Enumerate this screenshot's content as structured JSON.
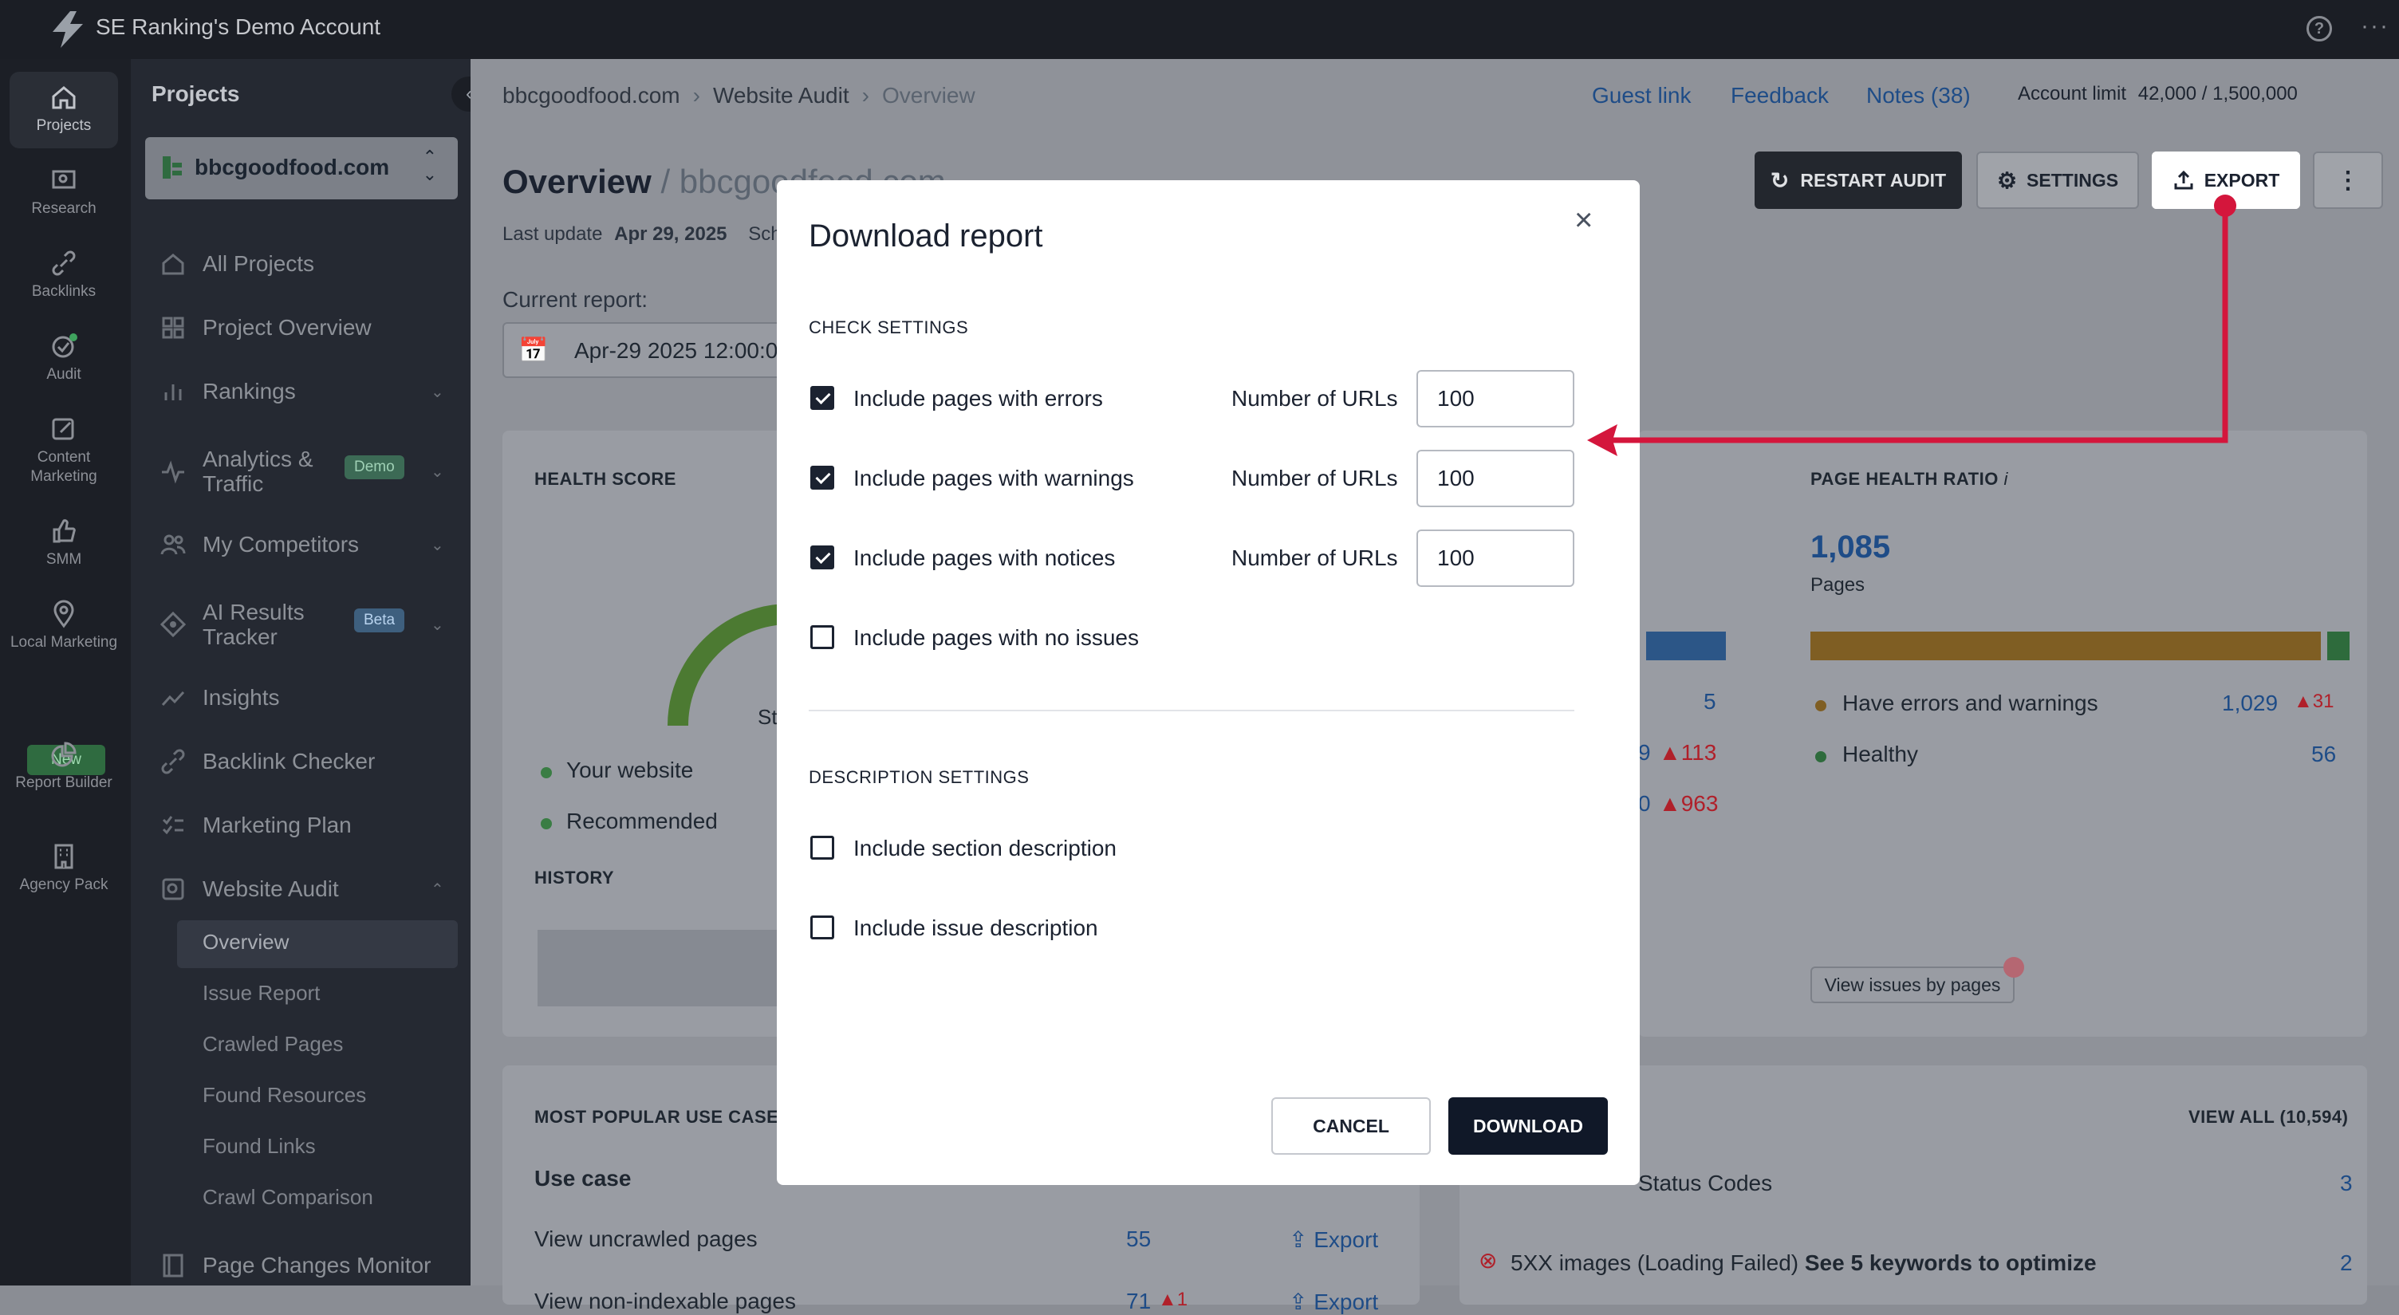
{
  "topbar": {
    "account_name": "SE Ranking's Demo Account",
    "help": "?",
    "more": "···"
  },
  "rail": [
    {
      "label": "Projects"
    },
    {
      "label": "Research"
    },
    {
      "label": "Backlinks"
    },
    {
      "label": "Audit"
    },
    {
      "label": "Content Marketing"
    },
    {
      "label": "SMM"
    },
    {
      "label": "Local Marketing"
    },
    {
      "label": "Report Builder"
    },
    {
      "label": "Agency Pack"
    }
  ],
  "rail_new_badge": "New",
  "sidebar": {
    "title": "Projects",
    "project": "bbcgoodfood.com",
    "nav": [
      {
        "label": "All Projects"
      },
      {
        "label": "Project Overview"
      },
      {
        "label": "Rankings"
      },
      {
        "label": "Analytics & Traffic",
        "badge": "Demo"
      },
      {
        "label": "My Competitors"
      },
      {
        "label": "AI Results Tracker",
        "badge": "Beta"
      },
      {
        "label": "Insights"
      },
      {
        "label": "Backlink Checker"
      },
      {
        "label": "Marketing Plan"
      },
      {
        "label": "Website Audit"
      }
    ],
    "sub": [
      "Overview",
      "Issue Report",
      "Crawled Pages",
      "Found Resources",
      "Found Links",
      "Crawl Comparison"
    ],
    "page_changes": "Page Changes Monitor"
  },
  "header": {
    "crumbs": [
      "bbcgoodfood.com",
      "Website Audit",
      "Overview"
    ],
    "guest_link": "Guest link",
    "feedback": "Feedback",
    "notes": "Notes (38)",
    "account_limit_label": "Account limit",
    "account_limit_value": "42,000 / 1,500,000",
    "info": "i"
  },
  "toolbar": {
    "restart": "RESTART AUDIT",
    "settings": "SETTINGS",
    "export": "EXPORT"
  },
  "overview": {
    "title": "Overview",
    "title_site": "/ bbcgoodfood.com",
    "last_update_label": "Last update",
    "last_update": "Apr 29, 2025",
    "sch": "Sch",
    "current_report": "Current report:",
    "report_date": "Apr-29 2025 12:00:0"
  },
  "health": {
    "title": "HEALTH SCORE",
    "your_site": "Your website",
    "recommended": "Recommended",
    "history": "HISTORY",
    "st": "St"
  },
  "middle": {
    "v1": "5",
    "v2": "9",
    "v3": "113",
    "v4": "0",
    "v5": "963"
  },
  "page_health": {
    "title": "PAGE HEALTH RATIO",
    "total": "1,085",
    "unit": "Pages",
    "row1_label": "Have errors and warnings",
    "row1_value": "1,029",
    "row1_delta": "31",
    "row2_label": "Healthy",
    "row2_value": "56",
    "view_btn": "View issues by pages"
  },
  "use_cases": {
    "title": "MOST POPULAR USE CASES",
    "col": "Use case",
    "row1": "View uncrawled pages",
    "row1_val": "55",
    "row1_action": "Export",
    "row2": "View non-indexable pages",
    "row2_val": "71",
    "row2_delta": "1",
    "row2_action": "Export"
  },
  "issues": {
    "view_all": "VIEW ALL (10,594)",
    "row1": "Status Codes",
    "row1_val": "3",
    "row2a": "5XX images (Loading Failed)",
    "row2b": "See 5 keywords to optimize",
    "row2_val": "2"
  },
  "modal": {
    "title": "Download report",
    "check_settings": "CHECK SETTINGS",
    "opt_errors": "Include pages with errors",
    "opt_warnings": "Include pages with warnings",
    "opt_notices": "Include pages with notices",
    "opt_noissues": "Include pages with no issues",
    "num_label": "Number of URLs",
    "num_errors": "100",
    "num_warnings": "100",
    "num_notices": "100",
    "desc_settings": "DESCRIPTION SETTINGS",
    "opt_section": "Include section description",
    "opt_issue": "Include issue description",
    "cancel": "CANCEL",
    "download": "DOWNLOAD",
    "close": "×",
    "checked": {
      "errors": true,
      "warnings": true,
      "notices": true,
      "noissues": false,
      "section": false,
      "issue": false
    }
  },
  "colors": {
    "accent_red": "#d4163c",
    "primary_dark": "#101828",
    "link_blue": "#1e4c87"
  }
}
